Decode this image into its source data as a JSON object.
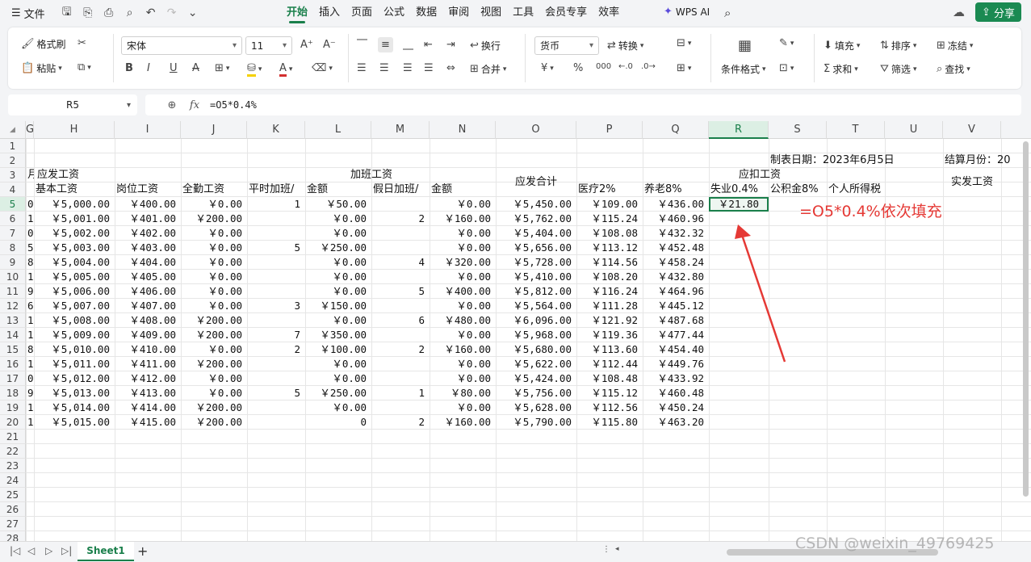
{
  "menubar": {
    "file_label": "文件",
    "tabs": [
      "开始",
      "插入",
      "页面",
      "公式",
      "数据",
      "审阅",
      "视图",
      "工具",
      "会员专享",
      "效率"
    ],
    "active_tab": "开始",
    "wps_ai_label": "WPS AI",
    "share_label": "分享"
  },
  "ribbon": {
    "format_painter": "格式刷",
    "paste": "粘贴",
    "font_name": "宋体",
    "font_size": "11",
    "wrap": "换行",
    "merge": "合并",
    "number_format": "货币",
    "convert": "转换",
    "conditional_format": "条件格式",
    "fill": "填充",
    "sort": "排序",
    "freeze": "冻结",
    "sum": "求和",
    "filter": "筛选",
    "find": "查找",
    "percent": "%",
    "thousands": "000",
    "currency_symbol": "¥"
  },
  "formula_bar": {
    "name_box": "R5",
    "fx_label": "fx",
    "formula": "=O5*0.4%"
  },
  "sheet": {
    "columns": [
      "G",
      "H",
      "I",
      "J",
      "K",
      "L",
      "M",
      "N",
      "O",
      "P",
      "Q",
      "R",
      "S",
      "T",
      "U",
      "V"
    ],
    "selected_column": "R",
    "rows": [
      "1",
      "2",
      "3",
      "4",
      "5",
      "6",
      "7",
      "8",
      "9",
      "10",
      "11",
      "12",
      "13",
      "14",
      "15",
      "16",
      "17",
      "18",
      "19",
      "20",
      "21",
      "22",
      "23",
      "24",
      "25",
      "26",
      "27",
      "28"
    ],
    "selected_row": "5",
    "header": {
      "date_label": "制表日期：2023年6月5日",
      "settle_label": "结算月份：20",
      "g3": "月",
      "yingfa_gongzi": "应发工资",
      "jiaban_gongzi": "加班工资",
      "yingfa_heji": "应发合计",
      "yingkou_gongzi": "应扣工资",
      "shifa_gongzi": "实发工资",
      "jiben": "基本工资",
      "gangwei": "岗位工资",
      "quanqin": "全勤工资",
      "pingshi": "平时加班/",
      "jine1": "金额",
      "jiari": "假日加班/",
      "jine2": "金额",
      "yiliao": "医疗2%",
      "yanglao": "养老8%",
      "shiye": "失业0.4%",
      "gongjijin": "公积金8%",
      "geshui": "个人所得税"
    },
    "data_rows": [
      {
        "g": "0",
        "h": "￥5,000.00",
        "i": "￥400.00",
        "j": "￥0.00",
        "k": "1",
        "l": "￥50.00",
        "m": "",
        "n": "￥0.00",
        "o": "￥5,450.00",
        "p": "￥109.00",
        "q": "￥436.00",
        "r": "￥21.80"
      },
      {
        "g": "1",
        "h": "￥5,001.00",
        "i": "￥401.00",
        "j": "￥200.00",
        "k": "",
        "l": "￥0.00",
        "m": "2",
        "n": "￥160.00",
        "o": "￥5,762.00",
        "p": "￥115.24",
        "q": "￥460.96",
        "r": ""
      },
      {
        "g": "0",
        "h": "￥5,002.00",
        "i": "￥402.00",
        "j": "￥0.00",
        "k": "",
        "l": "￥0.00",
        "m": "",
        "n": "￥0.00",
        "o": "￥5,404.00",
        "p": "￥108.08",
        "q": "￥432.32",
        "r": ""
      },
      {
        "g": "5",
        "h": "￥5,003.00",
        "i": "￥403.00",
        "j": "￥0.00",
        "k": "5",
        "l": "￥250.00",
        "m": "",
        "n": "￥0.00",
        "o": "￥5,656.00",
        "p": "￥113.12",
        "q": "￥452.48",
        "r": ""
      },
      {
        "g": "8",
        "h": "￥5,004.00",
        "i": "￥404.00",
        "j": "￥0.00",
        "k": "",
        "l": "￥0.00",
        "m": "4",
        "n": "￥320.00",
        "o": "￥5,728.00",
        "p": "￥114.56",
        "q": "￥458.24",
        "r": ""
      },
      {
        "g": "1",
        "h": "￥5,005.00",
        "i": "￥405.00",
        "j": "￥0.00",
        "k": "",
        "l": "￥0.00",
        "m": "",
        "n": "￥0.00",
        "o": "￥5,410.00",
        "p": "￥108.20",
        "q": "￥432.80",
        "r": ""
      },
      {
        "g": "9",
        "h": "￥5,006.00",
        "i": "￥406.00",
        "j": "￥0.00",
        "k": "",
        "l": "￥0.00",
        "m": "5",
        "n": "￥400.00",
        "o": "￥5,812.00",
        "p": "￥116.24",
        "q": "￥464.96",
        "r": ""
      },
      {
        "g": "6",
        "h": "￥5,007.00",
        "i": "￥407.00",
        "j": "￥0.00",
        "k": "3",
        "l": "￥150.00",
        "m": "",
        "n": "￥0.00",
        "o": "￥5,564.00",
        "p": "￥111.28",
        "q": "￥445.12",
        "r": ""
      },
      {
        "g": "1",
        "h": "￥5,008.00",
        "i": "￥408.00",
        "j": "￥200.00",
        "k": "",
        "l": "￥0.00",
        "m": "6",
        "n": "￥480.00",
        "o": "￥6,096.00",
        "p": "￥121.92",
        "q": "￥487.68",
        "r": ""
      },
      {
        "g": "1",
        "h": "￥5,009.00",
        "i": "￥409.00",
        "j": "￥200.00",
        "k": "7",
        "l": "￥350.00",
        "m": "",
        "n": "￥0.00",
        "o": "￥5,968.00",
        "p": "￥119.36",
        "q": "￥477.44",
        "r": ""
      },
      {
        "g": "8",
        "h": "￥5,010.00",
        "i": "￥410.00",
        "j": "￥0.00",
        "k": "2",
        "l": "￥100.00",
        "m": "2",
        "n": "￥160.00",
        "o": "￥5,680.00",
        "p": "￥113.60",
        "q": "￥454.40",
        "r": ""
      },
      {
        "g": "1",
        "h": "￥5,011.00",
        "i": "￥411.00",
        "j": "￥200.00",
        "k": "",
        "l": "￥0.00",
        "m": "",
        "n": "￥0.00",
        "o": "￥5,622.00",
        "p": "￥112.44",
        "q": "￥449.76",
        "r": ""
      },
      {
        "g": "0",
        "h": "￥5,012.00",
        "i": "￥412.00",
        "j": "￥0.00",
        "k": "",
        "l": "￥0.00",
        "m": "",
        "n": "￥0.00",
        "o": "￥5,424.00",
        "p": "￥108.48",
        "q": "￥433.92",
        "r": ""
      },
      {
        "g": "9",
        "h": "￥5,013.00",
        "i": "￥413.00",
        "j": "￥0.00",
        "k": "5",
        "l": "￥250.00",
        "m": "1",
        "n": "￥80.00",
        "o": "￥5,756.00",
        "p": "￥115.12",
        "q": "￥460.48",
        "r": ""
      },
      {
        "g": "1",
        "h": "￥5,014.00",
        "i": "￥414.00",
        "j": "￥200.00",
        "k": "",
        "l": "￥0.00",
        "m": "",
        "n": "￥0.00",
        "o": "￥5,628.00",
        "p": "￥112.56",
        "q": "￥450.24",
        "r": ""
      },
      {
        "g": "1",
        "h": "￥5,015.00",
        "i": "￥415.00",
        "j": "￥200.00",
        "k": "",
        "l": "0",
        "m": "2",
        "n": "￥160.00",
        "o": "￥5,790.00",
        "p": "￥115.80",
        "q": "￥463.20",
        "r": ""
      }
    ]
  },
  "annotation": "=O5*0.4%依次填充",
  "annotation_color": "#e53935",
  "accent_color": "#1a7f4b",
  "sheet_tab": "Sheet1",
  "watermark": "CSDN @weixin_49769425"
}
